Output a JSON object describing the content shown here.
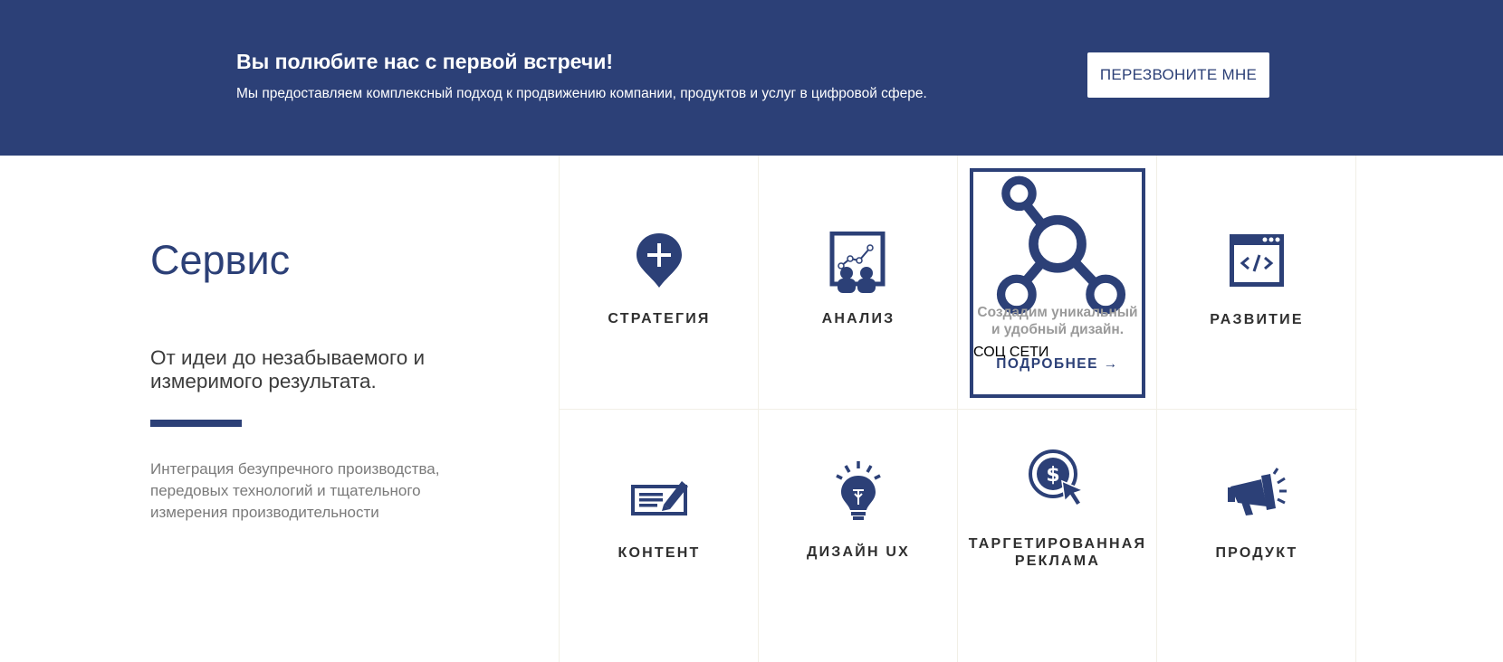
{
  "banner": {
    "title": "Вы полюбите нас с первой встречи!",
    "text": "Мы предоставляем комплексный подход к продвижению компании, продуктов и услуг в цифровой сфере.",
    "button_label": "ПЕРЕЗВОНИТЕ МНЕ"
  },
  "service": {
    "title": "Сервис",
    "subtitle": "От идеи до незабываемого и измеримого результата.",
    "description": "Интеграция безупречного производства, передовых технологий и тщательного измерения производительности"
  },
  "tiles": [
    {
      "label": "СТРАТЕГИЯ",
      "icon": "map-pin-plus-icon"
    },
    {
      "label": "АНАЛИЗ",
      "icon": "presentation-chart-icon"
    },
    {
      "label": "СОЦ СЕТИ",
      "icon": "social-network-icon",
      "description": "Создадим уникальный и удобный дизайн.",
      "more": "ПОДРОБНЕЕ →"
    },
    {
      "label": "РАЗВИТИЕ",
      "icon": "code-window-icon"
    },
    {
      "label": "КОНТЕНТ",
      "icon": "edit-document-icon"
    },
    {
      "label": "ДИЗАЙН UX",
      "icon": "lightbulb-icon"
    },
    {
      "label": "ТАРГЕТИРОВАННАЯ РЕКЛАМА",
      "icon": "dollar-click-icon"
    },
    {
      "label": "ПРОДУКТ",
      "icon": "megaphone-icon"
    }
  ],
  "colors": {
    "brand": "#2c4077",
    "text_dark": "#2f2f2f",
    "text_muted": "#7a7a7a",
    "grid_line": "#f1efe6"
  }
}
